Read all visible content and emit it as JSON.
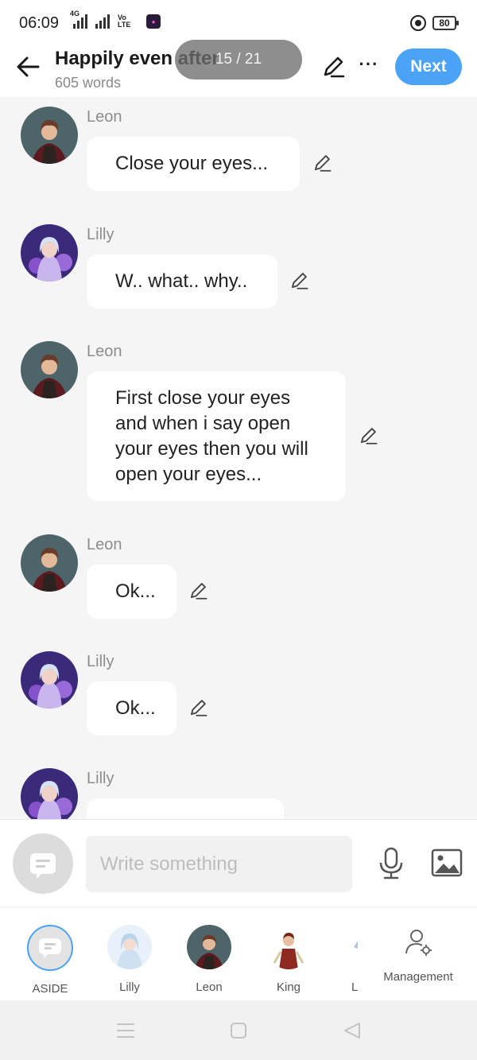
{
  "status_bar": {
    "time": "06:09",
    "network_tag": "4G",
    "volte": "Vo LTE",
    "app_badge": "",
    "battery": "80"
  },
  "header": {
    "title": "Happily even after",
    "word_count": "605 words",
    "page_indicator": "15 / 21",
    "next_label": "Next"
  },
  "messages": [
    {
      "speaker": "Leon",
      "text": "Close your eyes...",
      "avatar": "leon"
    },
    {
      "speaker": "Lilly",
      "text": "W.. what.. why..",
      "avatar": "lilly"
    },
    {
      "speaker": "Leon",
      "text": "First close your eyes and when i say open your eyes then you will open your eyes...",
      "avatar": "leon"
    },
    {
      "speaker": "Leon",
      "text": "Ok...",
      "avatar": "leon"
    },
    {
      "speaker": "Lilly",
      "text": "Ok...",
      "avatar": "lilly"
    },
    {
      "speaker": "Lilly",
      "text": "",
      "avatar": "lilly"
    }
  ],
  "composer": {
    "placeholder": "Write something"
  },
  "characters": [
    {
      "label": "ASIDE"
    },
    {
      "label": "Lilly"
    },
    {
      "label": "Leon"
    },
    {
      "label": "King"
    },
    {
      "label": "L"
    }
  ],
  "management_label": "Management",
  "icons": {
    "back": "arrow-left-icon",
    "edit": "pencil-icon",
    "more": "more-dots-icon",
    "mic": "microphone-icon",
    "image": "image-icon",
    "aside": "chat-bubble-icon",
    "management": "user-gear-icon"
  },
  "colors": {
    "accent": "#4aa3f5",
    "background": "#f5f5f5",
    "bubble": "#ffffff",
    "muted_text": "#8d8d8d"
  }
}
